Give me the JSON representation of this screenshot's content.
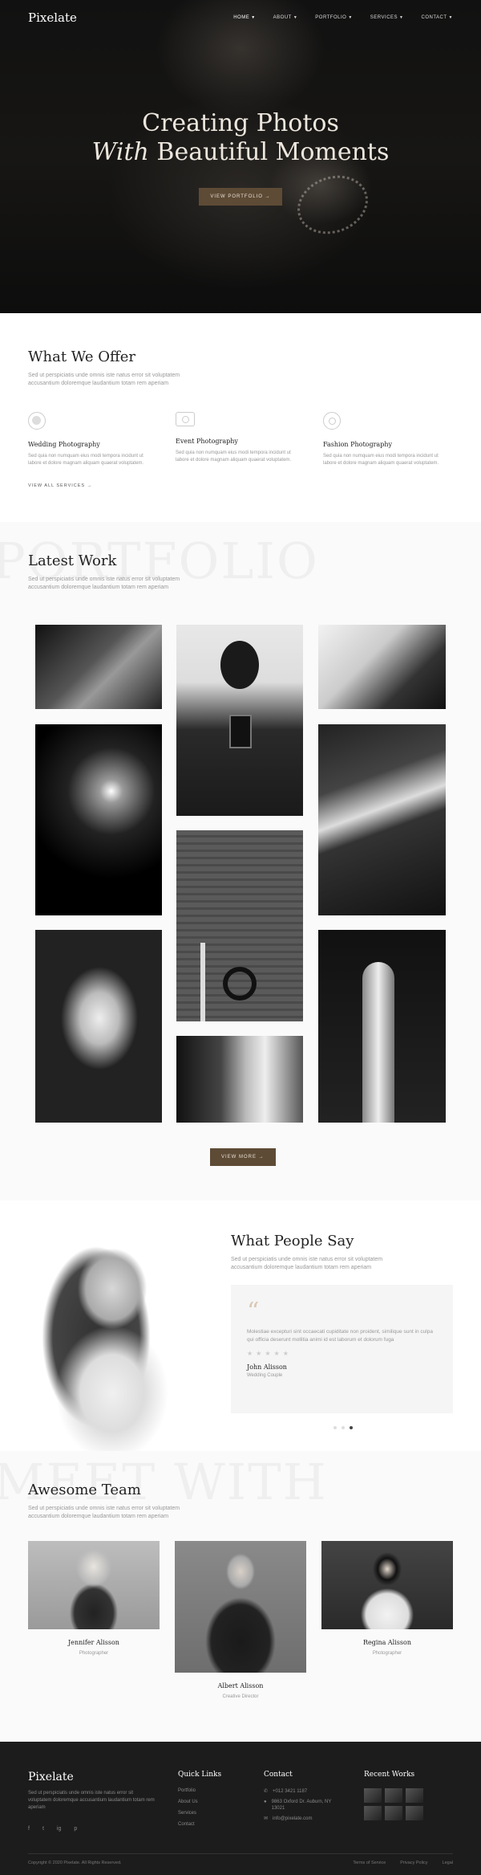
{
  "brand": "Pixelate",
  "nav": [
    {
      "label": "HOME",
      "active": true
    },
    {
      "label": "ABOUT"
    },
    {
      "label": "PORTFOLIO"
    },
    {
      "label": "SERVICES"
    },
    {
      "label": "CONTACT"
    }
  ],
  "hero": {
    "title_line1": "Creating Photos",
    "title_em": "With",
    "title_line2_rest": "Beautiful Moments",
    "button": "VIEW PORTFOLIO →"
  },
  "offer": {
    "title": "What We Offer",
    "subtitle": "Sed ut perspiciatis unde omnis iste natus error sit voluptatem accusantium doloremque laudantium totam rem aperiam",
    "services": [
      {
        "title": "Wedding Photography",
        "icon": "ring-icon",
        "desc": "Sed quia non numquam eius modi tempora incidunt ut labore et dolore magnam aliquam quaerat voluptatem."
      },
      {
        "title": "Event Photography",
        "icon": "camera-icon",
        "desc": "Sed quia non numquam eius modi tempora incidunt ut labore et dolore magnam aliquam quaerat voluptatem."
      },
      {
        "title": "Fashion Photography",
        "icon": "flower-icon",
        "desc": "Sed quia non numquam eius modi tempora incidunt ut labore et dolore magnam aliquam quaerat voluptatem."
      }
    ],
    "link": "VIEW ALL SERVICES →"
  },
  "work": {
    "watermark": "PORTFOLIO",
    "title": "Latest Work",
    "subtitle": "Sed ut perspiciatis unde omnis iste natus error sit voluptatem accusantium doloremque laudantium totam rem aperiam",
    "button": "VIEW MORE →"
  },
  "testimonials": {
    "title": "What People Say",
    "subtitle": "Sed ut perspiciatis unde omnis iste natus error sit voluptatem accusantium doloremque laudantium totam rem aperiam",
    "quote": "Molestiae excepturi sint occaecati cupiditate non proident, similique sunt in culpa qui officia deserunt mollitia animi id est laborum et dolorum fuga",
    "stars": "★★★★★",
    "name": "John Alisson",
    "role": "Wedding Couple"
  },
  "team": {
    "watermark": "MEET WITH",
    "title": "Awesome Team",
    "subtitle": "Sed ut perspiciatis unde omnis iste natus error sit voluptatem accusantium doloremque laudantium totam rem aperiam",
    "members": [
      {
        "name": "Jennifer Alisson",
        "role": "Photographer"
      },
      {
        "name": "Albert Alisson",
        "role": "Creative Director"
      },
      {
        "name": "Regina Alisson",
        "role": "Photographer"
      }
    ]
  },
  "footer": {
    "logo": "Pixelate",
    "desc": "Sed ut perspiciatis unde omnis iste natus error sit voluptatem doloremque accusantium laudantium totam rem aperiam",
    "social": [
      "f",
      "t",
      "ig",
      "p"
    ],
    "quick_title": "Quick Links",
    "quick_links": [
      "Portfolio",
      "About Us",
      "Services",
      "Contact"
    ],
    "contact_title": "Contact",
    "phone": "+012 3421 1187",
    "address": "9863 Oxford Dr. Auburn, NY 13021",
    "email": "info@pixelate.com",
    "recent_title": "Recent Works",
    "copyright": "Copyright © 2020 Pixelate. All Rights Reserved.",
    "legal": [
      "Terms of Service",
      "Privacy Policy",
      "Legal"
    ]
  }
}
